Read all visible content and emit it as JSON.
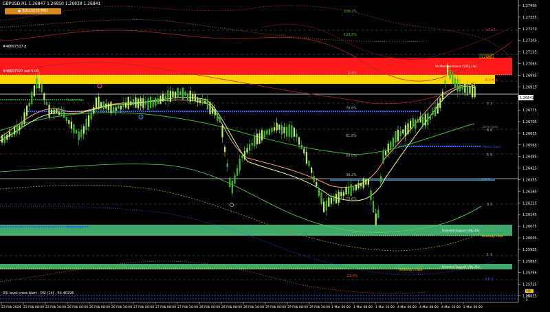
{
  "header": {
    "title": "GBPUSD,H1  1.26847 1.26850 1.26838 1.26841",
    "brand_label": "BULLSEYE PRO",
    "account_line_1": "#46697537 d",
    "account_line_2": "#46697537 sell 5.00"
  },
  "price_axis": {
    "labels": [
      "1.27400",
      "1.27335",
      "1.27270",
      "1.27205",
      "1.27135",
      "1.27065",
      "1.26995",
      "1.26915",
      "1.26841",
      "1.26775",
      "1.26705",
      "1.26635",
      "1.26565",
      "1.26495",
      "1.26425",
      "1.26355",
      "1.26285",
      "1.26215",
      "1.26145",
      "1.26075",
      "1.26005",
      "1.25935",
      "1.25865",
      "1.25795",
      "1.25725",
      "1.25655"
    ],
    "current_price": "1.26841"
  },
  "time_axis": {
    "labels": [
      "23 Feb 2024",
      "23 Feb 08:00",
      "23 Feb 16:00",
      "26 Feb 00:00",
      "26 Feb 08:00",
      "26 Feb 16:00",
      "27 Feb 00:00",
      "27 Feb 08:00",
      "27 Feb 16:00",
      "28 Feb 00:00",
      "28 Feb 08:00",
      "28 Feb 16:00",
      "29 Feb 00:00",
      "29 Feb 08:00",
      "29 Feb 16:00",
      "1 Mar 00:00",
      "1 Mar 08:00",
      "1 Mar 16:00",
      "4 Mar 00:00",
      "4 Mar 08:00",
      "4 Mar 16:00",
      "5 Mar 00:00"
    ]
  },
  "zones": {
    "resistance_label": "Verified Resistance (135p,1%)",
    "support_label_1": "Untested Support (49p,1%)",
    "support_label_2": "Untested Support (29p,1%)",
    "resistance_color": "#ff1a1a",
    "resistance_inner_color": "#ffd400",
    "support_color": "#3fa86b"
  },
  "fib_labels": [
    "138.2%",
    "123.6%",
    "100%",
    "78.6%",
    "61.8%",
    "50.0%",
    "38.2%",
    "23.6%",
    "-23.6%"
  ],
  "side_labels": {
    "r2": "+2+3",
    "r1": "6 5 4 4",
    "m1": "7 7",
    "m2": "6 6",
    "m3": "5 5",
    "m4": "4 4 4",
    "m5": "3 3",
    "m6": "1 1",
    "m7": "0 0 2",
    "daily_close": "Daily Close",
    "todays_open": "Today's Open",
    "todays_high": "Today's High",
    "weeks_open": "Week's Open",
    "yesterday_low": "Yesterday's Low",
    "yesterday_close": "Yesterday's Close",
    "small_box": "1.27065"
  },
  "rsi": {
    "text": "RSI level cross Alert - RSI (14) - 54.40295",
    "values_right": [
      "100",
      "50",
      "0"
    ]
  },
  "colors": {
    "candle": "#b6f55a",
    "down_candle": "#3dbb25",
    "fast_ma": "#ffa07a",
    "slow_ma": "#5ccf63",
    "band": "#b22222",
    "grid_dash": "#666666",
    "blue_dots": "#2d5bff"
  }
}
